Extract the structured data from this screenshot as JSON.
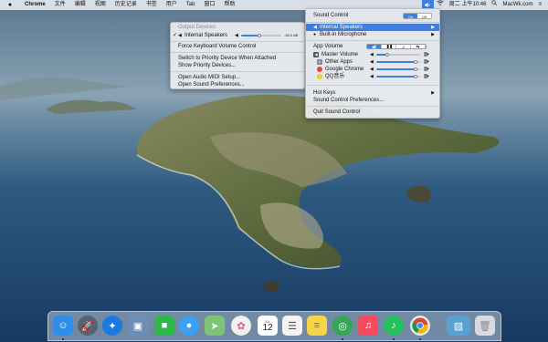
{
  "menubar": {
    "apple_icon": "apple-icon",
    "app_name": "Chrome",
    "menus": [
      "文件",
      "编辑",
      "视图",
      "历史记录",
      "书签",
      "用户",
      "Tab",
      "窗口",
      "帮助"
    ],
    "clock": "周二 上午10:46",
    "watermark": "MacWk.com"
  },
  "device_menu": {
    "header": "Output Devices:",
    "device": {
      "check": "✓",
      "label": "Internal Speakers",
      "level_text": "-34.0 dB",
      "level": 0.45
    },
    "items": [
      "Force Keyboard Volume Control",
      "Switch to Priority Device When Attached",
      "Show Priority Devices...",
      "Open Audio MIDI Setup...",
      "Open Sound Preferences..."
    ]
  },
  "sound_menu": {
    "title": "Sound Control",
    "toggle": {
      "on": "On",
      "off": "Off",
      "state": "on"
    },
    "output": "Internal Speakers",
    "input": "Built-in Microphone",
    "app_volume_label": "App Volume",
    "segments": [
      "◀)",
      "▐▐",
      "♫",
      "⇆"
    ],
    "rows": [
      {
        "label": "Master Volume",
        "level": 0.25
      },
      {
        "label": "Other Apps",
        "level": 0.9
      },
      {
        "label": "Google Chrome",
        "level": 0.9
      },
      {
        "label": "QQ音乐",
        "level": 0.9
      }
    ],
    "hot_keys": "Hot Keys",
    "preferences": "Sound Control Preferences...",
    "quit": "Quit Sound Control"
  },
  "dock": {
    "apps": [
      {
        "name": "Finder",
        "icon": "finder-icon",
        "color": "#2f8fe8"
      },
      {
        "name": "Launchpad",
        "icon": "launchpad-icon",
        "color": "#5a6270"
      },
      {
        "name": "Safari",
        "icon": "safari-icon",
        "color": "#1a78e0"
      },
      {
        "name": "Preview",
        "icon": "preview-icon",
        "color": "#6b8fb8"
      },
      {
        "name": "FaceTime",
        "icon": "facetime-icon",
        "color": "#2eb84a"
      },
      {
        "name": "Messages",
        "icon": "messages-icon",
        "color": "#3ca0f5"
      },
      {
        "name": "Maps",
        "icon": "maps-icon",
        "color": "#7cc476"
      },
      {
        "name": "Photos",
        "icon": "photos-icon",
        "color": "#f0f0f0"
      },
      {
        "name": "Calendar",
        "icon": "calendar-icon",
        "color": "#ffffff"
      },
      {
        "name": "Reminders",
        "icon": "reminders-icon",
        "color": "#f4f4f4"
      },
      {
        "name": "Notes",
        "icon": "notes-icon",
        "color": "#f8d548"
      },
      {
        "name": "Sound Control",
        "icon": "sound-control-icon",
        "color": "#32a852"
      },
      {
        "name": "Music",
        "icon": "music-icon",
        "color": "#f64b5d"
      },
      {
        "name": "QQ Music",
        "icon": "qq-music-icon",
        "color": "#24c25a"
      },
      {
        "name": "Google Chrome",
        "icon": "chrome-icon",
        "color": "#e8e8e8"
      },
      {
        "name": "Photo Folder",
        "icon": "folder-icon",
        "color": "#5aa0d0"
      },
      {
        "name": "Trash",
        "icon": "trash-icon",
        "color": "#d6dbe0"
      }
    ],
    "calendar_month": "JUL",
    "calendar_day": "12"
  }
}
